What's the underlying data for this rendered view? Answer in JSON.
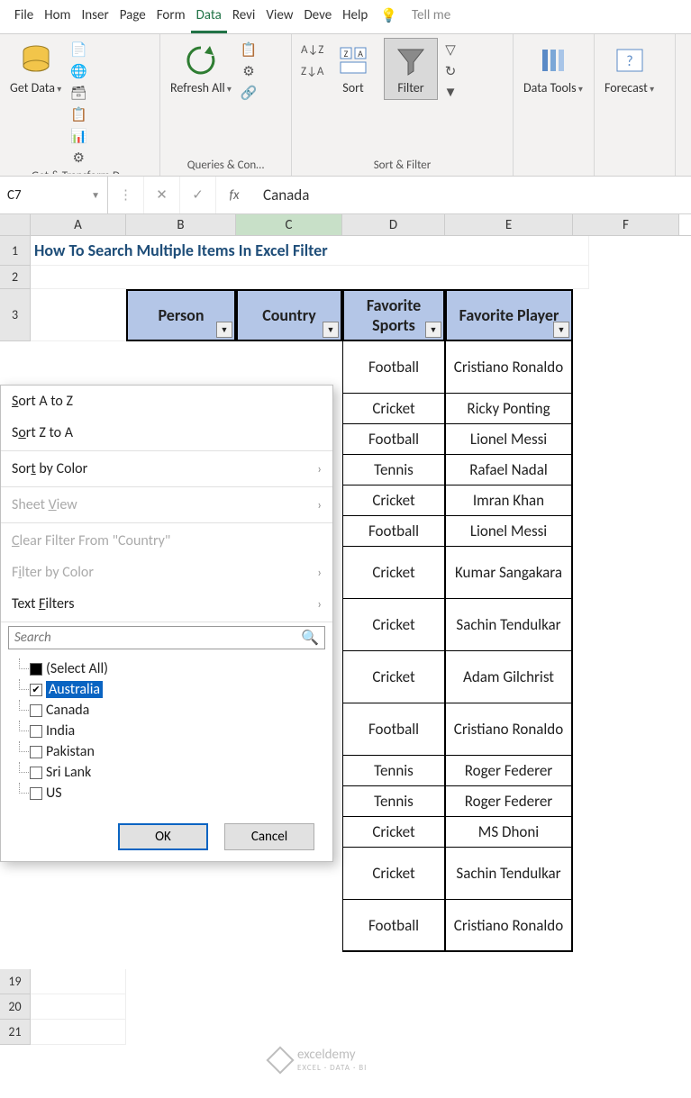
{
  "menubar": {
    "tabs": [
      "File",
      "Hom",
      "Inser",
      "Page",
      "Form",
      "Data",
      "Revi",
      "View",
      "Deve",
      "Help"
    ],
    "active_index": 5,
    "tell_me": "Tell me"
  },
  "ribbon": {
    "groups": [
      {
        "label": "Get & Transform D…",
        "buttons": [
          {
            "label": "Get Data",
            "dropdown": true
          }
        ]
      },
      {
        "label": "Queries & Con…",
        "buttons": [
          {
            "label": "Refresh All",
            "dropdown": true
          }
        ]
      },
      {
        "label": "Sort & Filter",
        "buttons": [
          {
            "label": "Sort"
          },
          {
            "label": "Filter",
            "pressed": true
          }
        ]
      },
      {
        "label": "",
        "buttons": [
          {
            "label": "Data Tools",
            "dropdown": true
          }
        ]
      },
      {
        "label": "",
        "buttons": [
          {
            "label": "Forecast",
            "dropdown": true
          }
        ]
      }
    ]
  },
  "formula_bar": {
    "cell_ref": "C7",
    "value": "Canada"
  },
  "columns": [
    "A",
    "B",
    "C",
    "D",
    "E",
    "F"
  ],
  "selected_col_index": 2,
  "title_text": "How To Search Multiple Items In Excel Filter",
  "table_headers": [
    "Person",
    "Country",
    "Favorite Sports",
    "Favorite Player"
  ],
  "data_rows": [
    {
      "sport": "Football",
      "player": "Cristiano Ronaldo",
      "tall": true
    },
    {
      "sport": "Cricket",
      "player": "Ricky Ponting"
    },
    {
      "sport": "Football",
      "player": "Lionel Messi"
    },
    {
      "sport": "Tennis",
      "player": "Rafael Nadal"
    },
    {
      "sport": "Cricket",
      "player": "Imran Khan"
    },
    {
      "sport": "Football",
      "player": "Lionel Messi"
    },
    {
      "sport": "Cricket",
      "player": "Kumar Sangakara",
      "tall": true
    },
    {
      "sport": "Cricket",
      "player": "Sachin Tendulkar",
      "tall": true
    },
    {
      "sport": "Cricket",
      "player": "Adam Gilchrist",
      "tall": true
    },
    {
      "sport": "Football",
      "player": "Cristiano Ronaldo",
      "tall": true
    },
    {
      "sport": "Tennis",
      "player": "Roger Federer"
    },
    {
      "sport": "Tennis",
      "player": "Roger Federer"
    },
    {
      "sport": "Cricket",
      "player": "MS Dhoni"
    },
    {
      "sport": "Cricket",
      "player": "Sachin Tendulkar",
      "tall": true
    },
    {
      "sport": "Football",
      "player": "Cristiano Ronaldo",
      "tall": true
    }
  ],
  "extra_row_headers": [
    "19",
    "20",
    "21"
  ],
  "filter_popup": {
    "items": [
      {
        "label": "Sort A to Z",
        "disabled": false,
        "u": 0
      },
      {
        "label": "Sort Z to A",
        "disabled": false,
        "u": 1
      },
      {
        "label": "Sort by Color",
        "arrow": true,
        "u": 3
      },
      {
        "label": "Sheet View",
        "disabled": true,
        "arrow": true,
        "u": 6
      },
      {
        "label": "Clear Filter From \"Country\"",
        "disabled": true,
        "u": 0
      },
      {
        "label": "Filter by Color",
        "disabled": true,
        "arrow": true,
        "u": 1
      },
      {
        "label": "Text Filters",
        "arrow": true,
        "u": 5
      }
    ],
    "search_placeholder": "Search",
    "tree": [
      {
        "label": "(Select All)",
        "state": "mixed"
      },
      {
        "label": "Australia",
        "state": "checked",
        "selected": true
      },
      {
        "label": "Canada",
        "state": ""
      },
      {
        "label": "India",
        "state": ""
      },
      {
        "label": "Pakistan",
        "state": ""
      },
      {
        "label": "Sri Lank",
        "state": ""
      },
      {
        "label": "US",
        "state": ""
      }
    ],
    "ok": "OK",
    "cancel": "Cancel"
  },
  "watermark": {
    "brand": "exceldemy",
    "tagline": "EXCEL · DATA · BI"
  }
}
